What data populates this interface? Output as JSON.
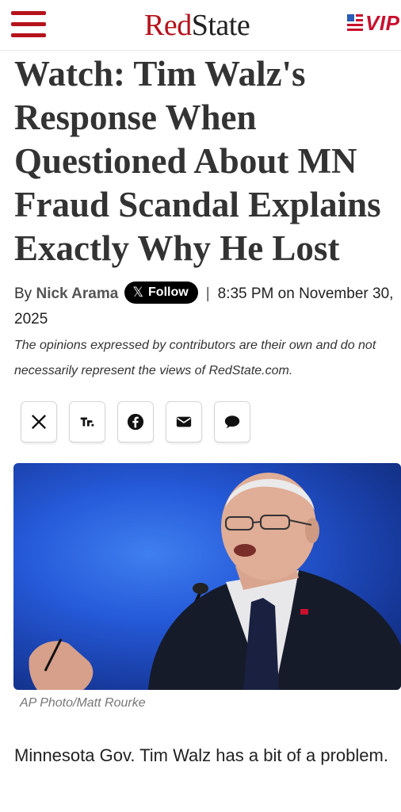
{
  "header": {
    "logo_red": "Red",
    "logo_state": "State",
    "vip_label": "VIP",
    "colors": {
      "brand_red": "#b5121b",
      "vip_red": "#c8102e",
      "vip_blue": "#2a5bb5"
    }
  },
  "article": {
    "headline": "Watch: Tim Walz's Response When Questioned About MN Fraud Scandal Explains Exactly Why He Lost",
    "byline_prefix": "By",
    "author": "Nick Arama",
    "follow_label": "Follow",
    "follow_icon": "x-logo-icon",
    "separator": "|",
    "timestamp": "8:35 PM on November 30, 2025",
    "disclaimer": "The opinions expressed by contributors are their own and do not necessarily represent the views of RedState.com.",
    "share_buttons": [
      {
        "name": "share-x-button",
        "icon": "x-logo-icon"
      },
      {
        "name": "share-truth-social-button",
        "icon": "truth-social-icon"
      },
      {
        "name": "share-facebook-button",
        "icon": "facebook-icon"
      },
      {
        "name": "share-email-button",
        "icon": "email-icon"
      },
      {
        "name": "share-comment-button",
        "icon": "comment-bubble-icon"
      }
    ],
    "photo_caption": "AP Photo/Matt Rourke",
    "first_paragraph": "Minnesota Gov. Tim Walz has a bit of a problem."
  }
}
